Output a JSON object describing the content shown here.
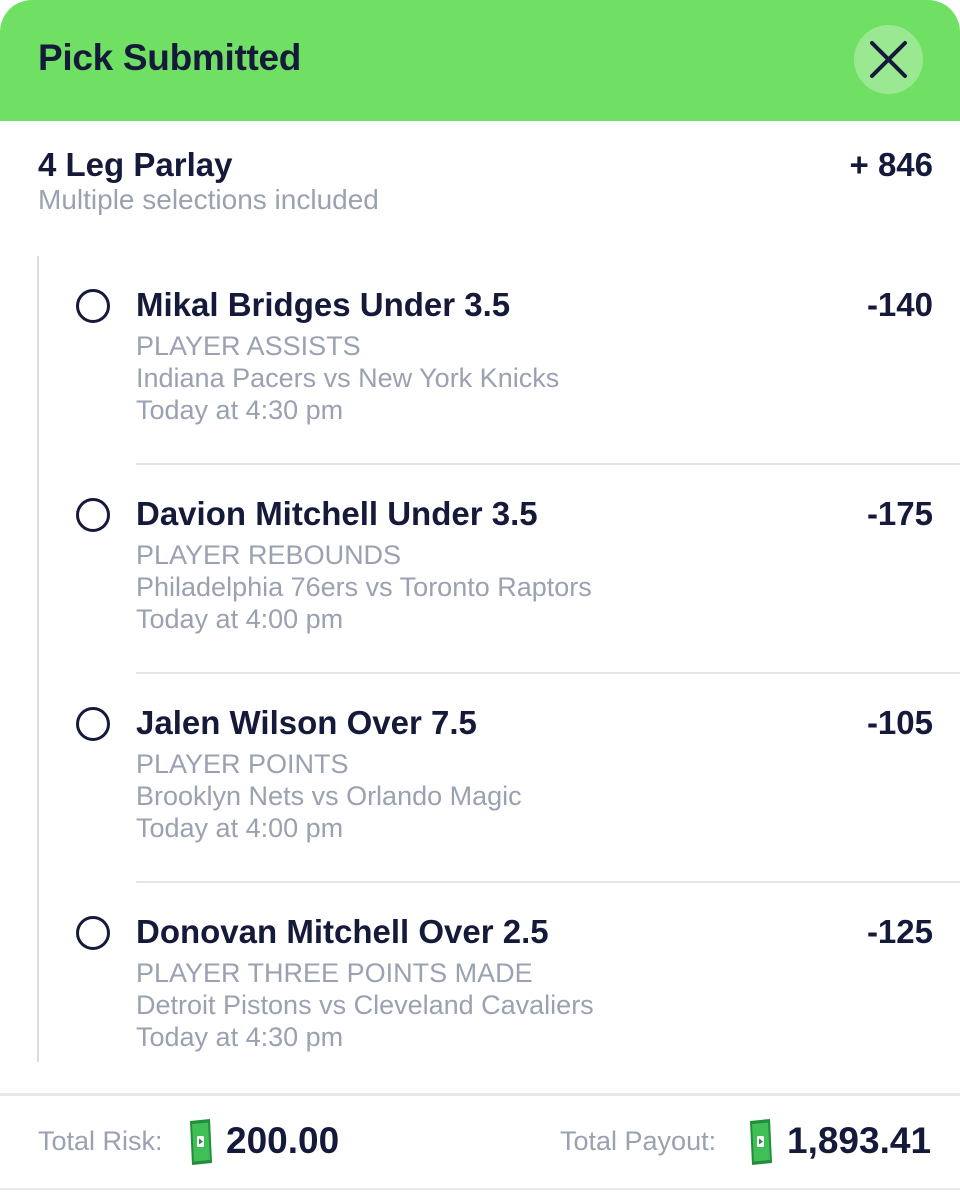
{
  "header": {
    "title": "Pick Submitted",
    "close_icon": "close-icon",
    "background_color": "#6fe063"
  },
  "parlay": {
    "title": "4 Leg Parlay",
    "subtitle": "Multiple selections included",
    "odds": "+ 846"
  },
  "legs": [
    {
      "title": "Mikal Bridges Under 3.5",
      "odds": "-140",
      "market": "PLAYER ASSISTS",
      "matchup": "Indiana Pacers vs New York Knicks",
      "time": "Today at 4:30 pm"
    },
    {
      "title": "Davion Mitchell Under 3.5",
      "odds": "-175",
      "market": "PLAYER REBOUNDS",
      "matchup": "Philadelphia 76ers vs Toronto Raptors",
      "time": "Today at 4:00 pm"
    },
    {
      "title": "Jalen Wilson Over 7.5",
      "odds": "-105",
      "market": "PLAYER POINTS",
      "matchup": "Brooklyn Nets vs Orlando Magic",
      "time": "Today at 4:00 pm"
    },
    {
      "title": "Donovan Mitchell Over 2.5",
      "odds": "-125",
      "market": "PLAYER THREE POINTS MADE",
      "matchup": "Detroit Pistons vs Cleveland Cavaliers",
      "time": "Today at 4:30 pm"
    }
  ],
  "footer": {
    "risk_label": "Total Risk:",
    "risk_value": "200.00",
    "payout_label": "Total Payout:",
    "payout_value": "1,893.41",
    "currency_icon": "cash-icon"
  }
}
